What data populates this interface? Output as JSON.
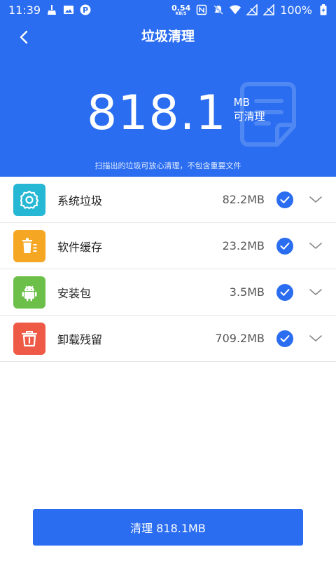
{
  "status_bar": {
    "time": "11:39",
    "net_speed_value": "0.54",
    "net_speed_unit": "KB/S",
    "battery": "100%"
  },
  "header": {
    "title": "垃圾清理",
    "total_value": "818.1",
    "total_unit": "MB",
    "total_caption": "可清理",
    "hint": "扫描出的垃圾可放心清理，不包含重要文件"
  },
  "items": [
    {
      "label": "系统垃圾",
      "size": "82.2MB",
      "checked": true,
      "icon": "gear-icon",
      "icon_color": "#25b7d3"
    },
    {
      "label": "软件缓存",
      "size": "23.2MB",
      "checked": true,
      "icon": "trash-list-icon",
      "icon_color": "#f5a623"
    },
    {
      "label": "安装包",
      "size": "3.5MB",
      "checked": true,
      "icon": "android-icon",
      "icon_color": "#6cc04a"
    },
    {
      "label": "卸载残留",
      "size": "709.2MB",
      "checked": true,
      "icon": "uninstall-bin-icon",
      "icon_color": "#ee5a45"
    }
  ],
  "clean_button": {
    "label": "清理 818.1MB"
  },
  "colors": {
    "primary": "#2a6df0"
  }
}
